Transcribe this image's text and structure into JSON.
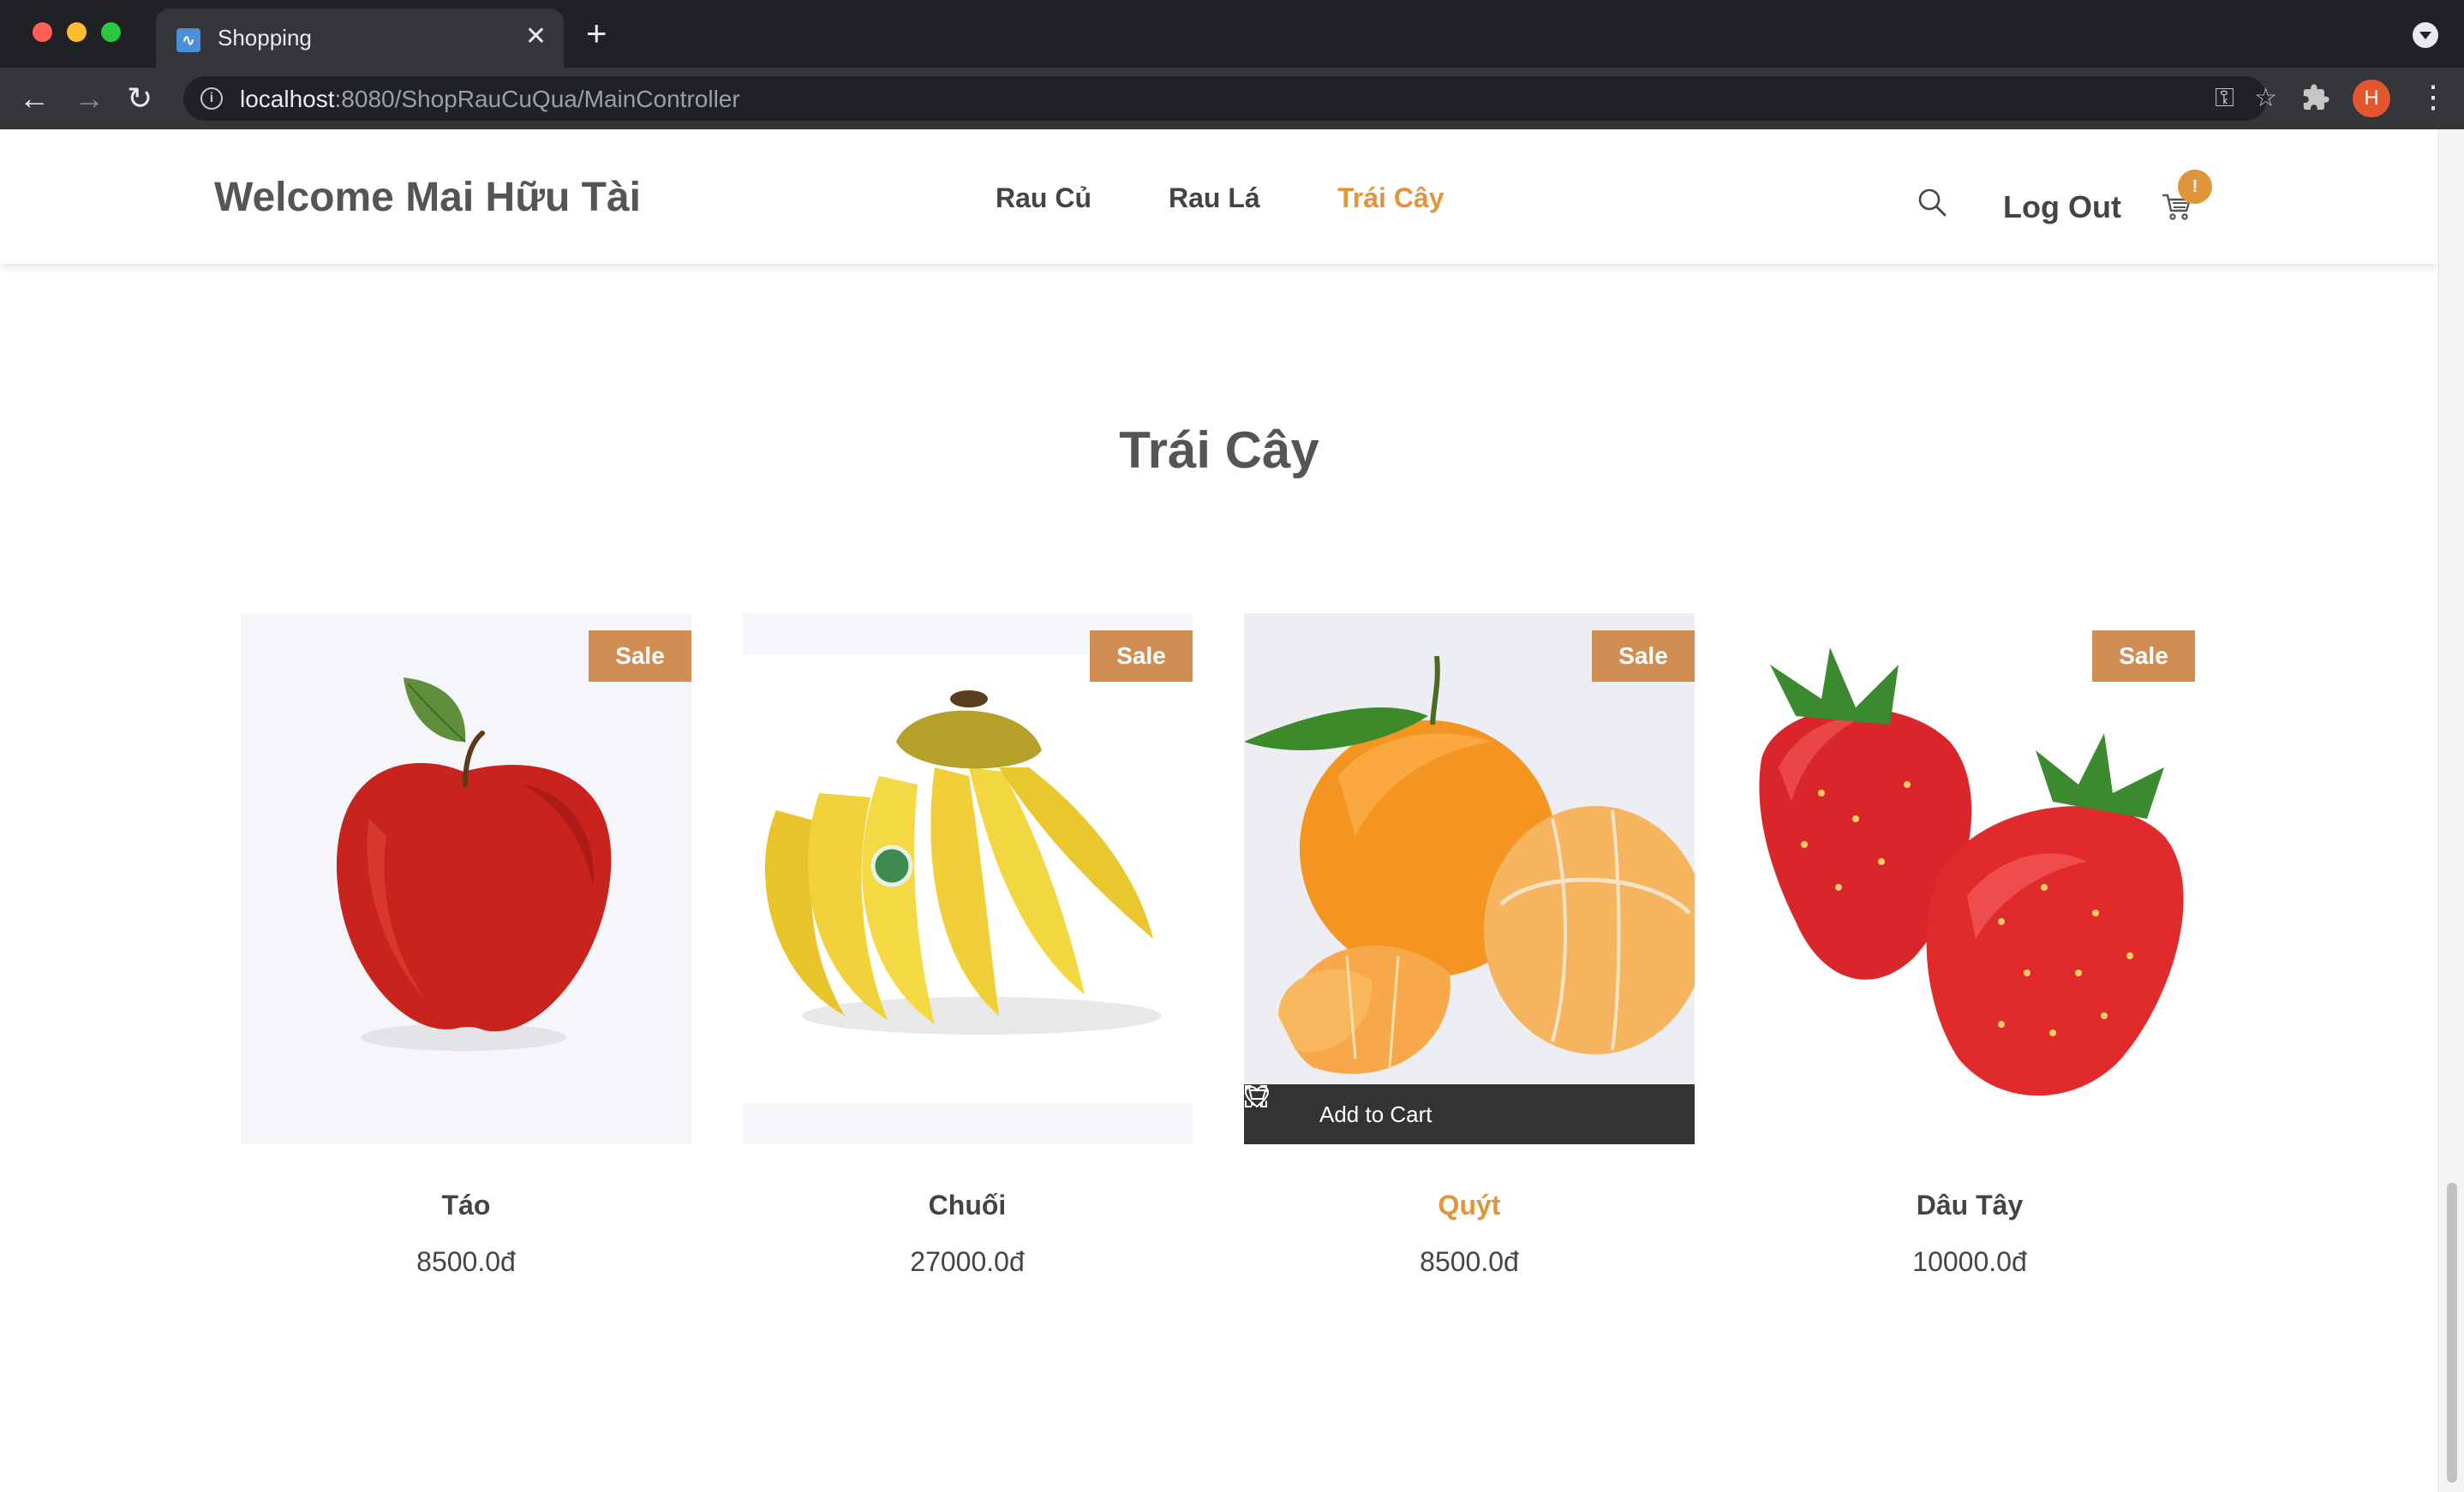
{
  "browser": {
    "tab_title": "Shopping",
    "tab_close": "✕",
    "new_tab": "+",
    "url_host": "localhost",
    "url_rest": ":8080/ShopRauCuQua/MainController",
    "profile_initial": "H",
    "icons": [
      "back-icon",
      "forward-icon",
      "reload-icon",
      "info-icon",
      "key-icon",
      "star-icon",
      "extensions-icon",
      "menu-icon"
    ]
  },
  "header": {
    "brand": "Welcome Mai Hữu Tài",
    "menu": [
      {
        "label": "Rau Củ",
        "active": false
      },
      {
        "label": "Rau Lá",
        "active": false
      },
      {
        "label": "Trái Cây",
        "active": true
      }
    ],
    "logout": "Log Out",
    "cart_badge": "!",
    "accent_color": "#e0953a"
  },
  "section": {
    "title": "Trái Cây"
  },
  "products": [
    {
      "name": "Táo",
      "price": "8500.0đ",
      "badge": "Sale",
      "image": "apple"
    },
    {
      "name": "Chuối",
      "price": "27000.0đ",
      "badge": "Sale",
      "image": "bananas"
    },
    {
      "name": "Quýt",
      "price": "8500.0đ",
      "badge": "Sale",
      "image": "tangerines",
      "hovered": true
    },
    {
      "name": "Dâu Tây",
      "price": "10000.0đ",
      "badge": "Sale",
      "image": "strawberries"
    }
  ],
  "hover_bar": {
    "add_to_cart": "Add to Cart"
  }
}
